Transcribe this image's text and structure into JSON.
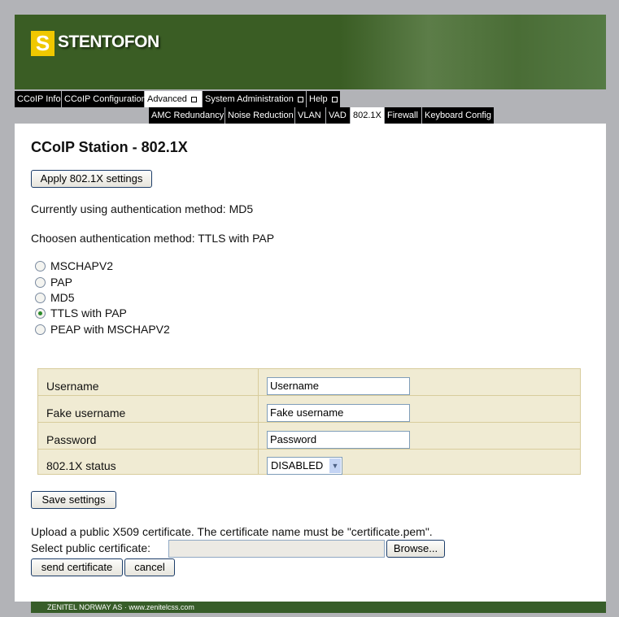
{
  "brand": {
    "logo_letter": "S",
    "name": "STENTOFON"
  },
  "nav": {
    "main": [
      {
        "label": "CCoIP Info"
      },
      {
        "label": "CCoIP Configuration"
      },
      {
        "label": "Advanced"
      },
      {
        "label": "System Administration"
      },
      {
        "label": "Help"
      }
    ],
    "sub": [
      {
        "label": "AMC Redundancy"
      },
      {
        "label": "Noise Reduction"
      },
      {
        "label": "VLAN"
      },
      {
        "label": "VAD"
      },
      {
        "label": "802.1X"
      },
      {
        "label": "Firewall"
      },
      {
        "label": "Keyboard Config"
      }
    ]
  },
  "page": {
    "title": "CCoIP Station - 802.1X",
    "apply_label": "Apply 802.1X settings",
    "current_method": "Currently using authentication method: MD5",
    "chosen_method": "Choosen authentication method: TTLS with PAP",
    "methods": [
      {
        "label": "MSCHAPV2",
        "selected": false
      },
      {
        "label": "PAP",
        "selected": false
      },
      {
        "label": "MD5",
        "selected": false
      },
      {
        "label": "TTLS with PAP",
        "selected": true
      },
      {
        "label": "PEAP with MSCHAPV2",
        "selected": false
      }
    ],
    "form": {
      "username_label": "Username",
      "username_value": "Username",
      "fake_label": "Fake username",
      "fake_value": "Fake username",
      "password_label": "Password",
      "password_value": "Password",
      "status_label": "802.1X status",
      "status_value": "DISABLED"
    },
    "save_label": "Save settings",
    "upload_text": "Upload a public X509 certificate. The certificate name must be \"certificate.pem\".",
    "select_label": "Select public certificate:",
    "file_value": "",
    "browse_label": "Browse...",
    "send_label": "send certificate",
    "cancel_label": "cancel"
  },
  "footer": {
    "text": "ZENITEL NORWAY AS · www.zenitelcss.com"
  }
}
